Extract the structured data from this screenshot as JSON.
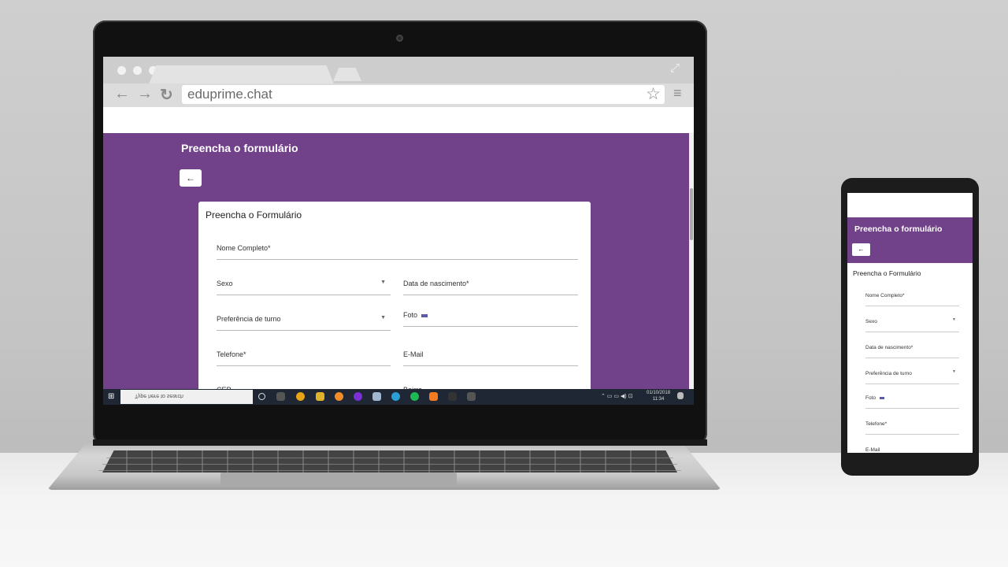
{
  "browser": {
    "url": "eduprime.chat",
    "back_icon": "←",
    "forward_icon": "→",
    "reload_icon": "↻",
    "star_icon": "☆",
    "menu_icon": "≡",
    "expand_icon": "⤢"
  },
  "page": {
    "title": "Preencha o formulário",
    "back_button": "←",
    "card_title": "Preencha o Formulário",
    "fields": {
      "nome": "Nome Completo*",
      "sexo": "Sexo",
      "nascimento": "Data de nascimento*",
      "turno": "Preferência de turno",
      "foto": "Foto",
      "telefone": "Telefone*",
      "email": "E-Mail",
      "cep": "CEP",
      "bairro": "Bairro"
    },
    "accent_color": "#71418a"
  },
  "taskbar": {
    "search_placeholder": "Type here to search",
    "date": "01/10/2018",
    "time": "11:34"
  },
  "phone": {
    "title": "Preencha o formulário",
    "back_button": "←",
    "card_title": "Preencha o Formulário",
    "fields": [
      "Nome Completo*",
      "Sexo",
      "Data de nascimento*",
      "Preferência de turno",
      "Foto",
      "Telefone*",
      "E-Mail"
    ]
  }
}
